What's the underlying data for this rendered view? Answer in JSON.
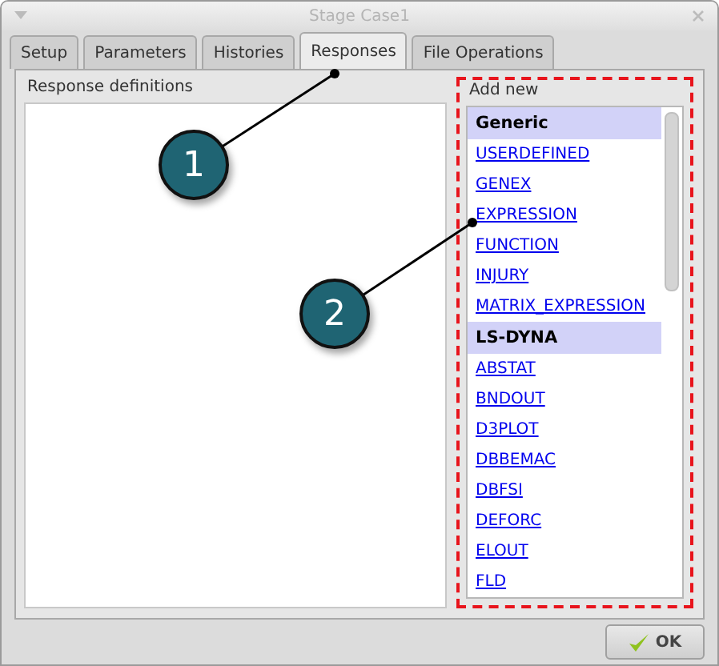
{
  "window": {
    "title": "Stage Case1"
  },
  "tabs": [
    {
      "label": "Setup",
      "selected": false
    },
    {
      "label": "Parameters",
      "selected": false
    },
    {
      "label": "Histories",
      "selected": false
    },
    {
      "label": "Responses",
      "selected": true
    },
    {
      "label": "File Operations",
      "selected": false
    }
  ],
  "definitions": {
    "label": "Response definitions"
  },
  "add_new": {
    "label": "Add new",
    "highlighted": true,
    "sections": [
      {
        "header": "Generic",
        "items": [
          "USERDEFINED",
          "GENEX",
          "EXPRESSION",
          "FUNCTION",
          "INJURY",
          "MATRIX_EXPRESSION"
        ]
      },
      {
        "header": "LS-DYNA",
        "items": [
          "ABSTAT",
          "BNDOUT",
          "D3PLOT",
          "DBBEMAC",
          "DBFSI",
          "DEFORC",
          "ELOUT",
          "FLD"
        ]
      }
    ]
  },
  "buttons": [
    {
      "label": "OK"
    }
  ],
  "callouts": [
    {
      "label": "1"
    },
    {
      "label": "2"
    }
  ]
}
